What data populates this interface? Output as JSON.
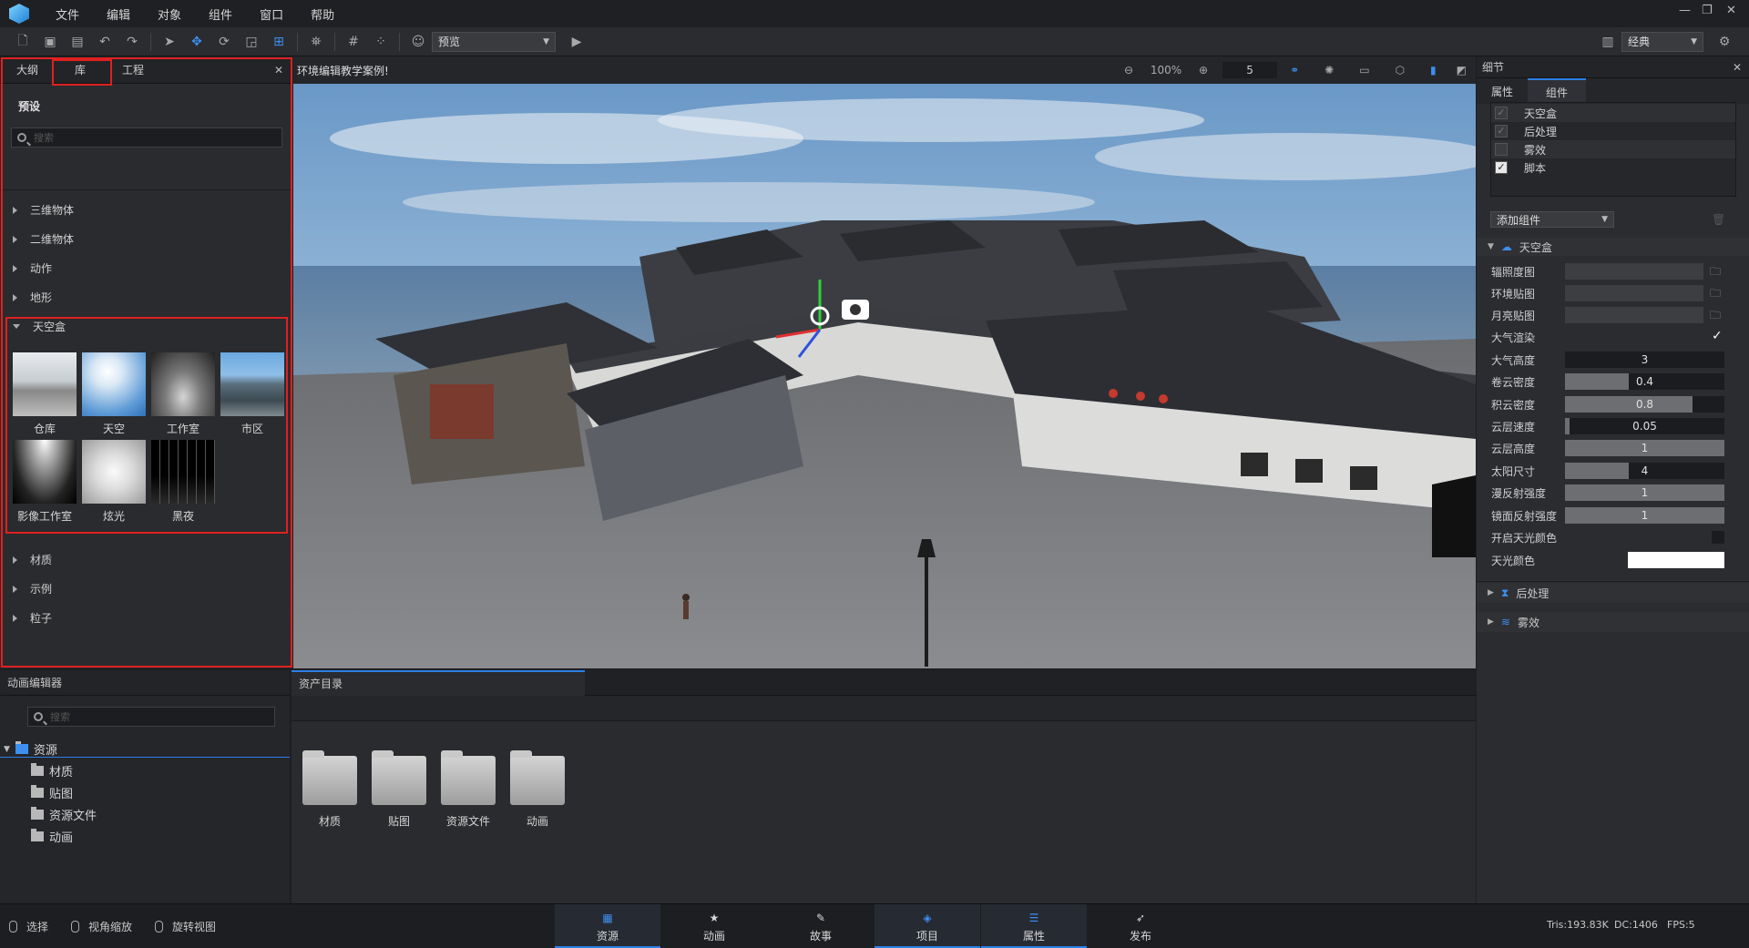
{
  "menu": [
    "文件",
    "编辑",
    "对象",
    "组件",
    "窗口",
    "帮助"
  ],
  "toolbar": {
    "mode_select": "预览",
    "layout_select": "经典"
  },
  "left_panel": {
    "tabs": [
      "大纲",
      "库",
      "工程"
    ],
    "preset_title": "预设",
    "search_placeholder": "搜索",
    "categories": [
      "三维物体",
      "二维物体",
      "动作",
      "地形",
      "天空盒",
      "材质",
      "示例",
      "粒子"
    ],
    "skybox_items": [
      "仓库",
      "天空",
      "工作室",
      "市区",
      "影像工作室",
      "炫光",
      "黑夜"
    ]
  },
  "viewport": {
    "title": "环境编辑教学案例!",
    "zoom": "100%",
    "speed": "5"
  },
  "anim_panel": {
    "title": "动画编辑器",
    "search_placeholder": "搜索",
    "tree_root": "资源",
    "tree_children": [
      "材质",
      "贴图",
      "资源文件",
      "动画"
    ]
  },
  "asset_panel": {
    "title": "资产目录",
    "folders": [
      "材质",
      "贴图",
      "资源文件",
      "动画"
    ]
  },
  "right_panel": {
    "title": "细节",
    "tabs": [
      "属性",
      "组件"
    ],
    "components": [
      {
        "label": "天空盒",
        "checked": true
      },
      {
        "label": "后处理",
        "checked": true
      },
      {
        "label": "雾效",
        "checked": false
      },
      {
        "label": "脚本",
        "checked": true
      }
    ],
    "add_component": "添加组件",
    "section_skybox": "天空盒",
    "props": {
      "irradiance": "辐照度图",
      "env_map": "环境贴图",
      "moon_map": "月亮贴图",
      "atmo_render": "大气渲染",
      "atmo_height": "大气高度",
      "cirrus_density": "卷云密度",
      "cumulus_density": "积云密度",
      "cloud_speed": "云层速度",
      "cloud_height": "云层高度",
      "sun_size": "太阳尺寸",
      "diffuse": "漫反射强度",
      "specular": "镜面反射强度",
      "skylight_enable": "开启天光颜色",
      "skylight_color": "天光颜色"
    },
    "values": {
      "atmo_height": "3",
      "cirrus_density": "0.4",
      "cumulus_density": "0.8",
      "cloud_speed": "0.05",
      "cloud_height": "1",
      "sun_size": "4",
      "diffuse": "1",
      "specular": "1"
    },
    "section_post": "后处理",
    "section_fog": "雾效"
  },
  "status": {
    "select": "选择",
    "zoom": "视角缩放",
    "rotate": "旋转视图",
    "tris": "Tris:193.83K",
    "dc": "DC:1406",
    "fps": "FPS:5"
  },
  "bottom_tabs": [
    "资源",
    "动画",
    "故事",
    "项目",
    "属性",
    "发布"
  ],
  "colors": {
    "accent": "#2d7fe6",
    "highlight": "#e02020"
  }
}
